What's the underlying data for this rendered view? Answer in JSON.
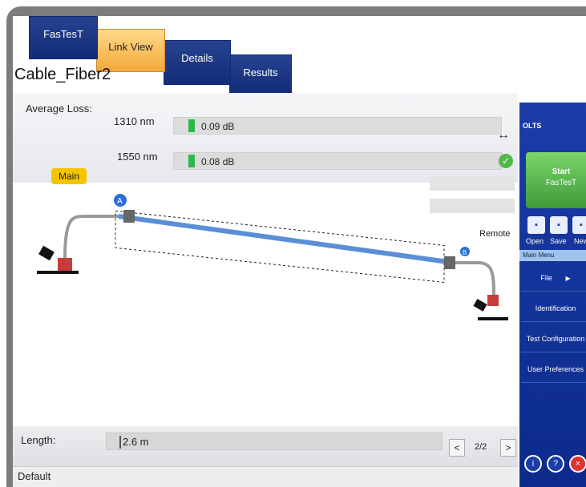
{
  "tabs": [
    "FasTesT",
    "Link View",
    "Details",
    "Results"
  ],
  "active_tab": "Link View",
  "cable_name": "Cable_Fiber2",
  "average_loss": {
    "label": "Average Loss:",
    "rows": [
      {
        "wavelength": "1310 nm",
        "value": "0.09 dB"
      },
      {
        "wavelength": "1550 nm",
        "value": "0.08 dB"
      }
    ]
  },
  "link": {
    "main_label": "Main",
    "end_a": "A",
    "end_b": "B",
    "remote_label": "Remote"
  },
  "length": {
    "label": "Length:",
    "value": "2.6 m"
  },
  "pager": {
    "prev": "<",
    "count": "2/2",
    "next": ">"
  },
  "status": "Default",
  "side_panel": {
    "title": "OLTS",
    "start_line1": "Start",
    "start_line2": "FasTesT",
    "tools": [
      "Open",
      "Save",
      "New"
    ],
    "menu_header": "Main Menu",
    "menu": [
      "File",
      "Identification",
      "Test Configuration",
      "User Preferences"
    ],
    "file_arrow": "▶"
  },
  "icons": {
    "arrows": "↔",
    "ok": "✓",
    "info": "i",
    "help": "?",
    "close": "×"
  },
  "colors": {
    "tab_blue": "#122c78",
    "tab_active": "#f4a93a",
    "meter_green": "#2fb84a",
    "badge_yellow": "#f5c400",
    "fiber_blue": "#5a8fd8"
  }
}
